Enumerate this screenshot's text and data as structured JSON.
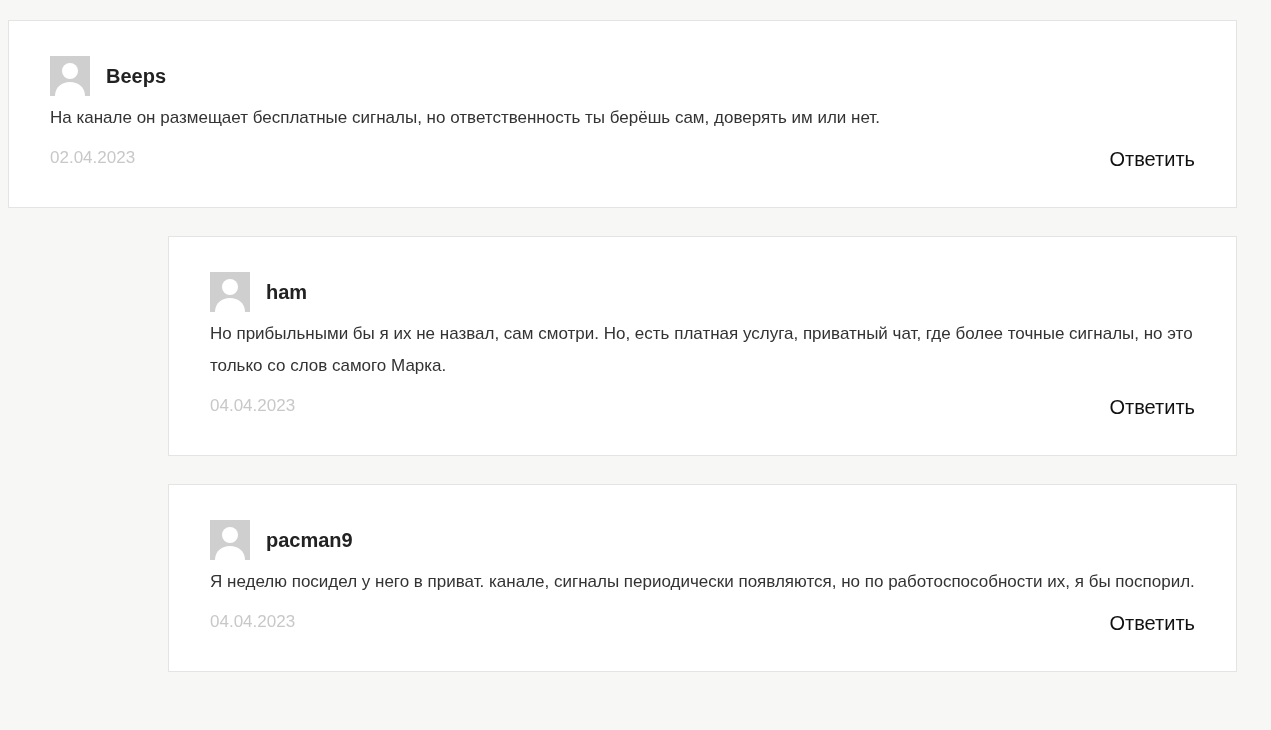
{
  "comments": [
    {
      "author": "Beeps",
      "text": "На канале он размещает бесплатные сигналы, но ответственность ты берёшь сам, доверять им или нет.",
      "date": "02.04.2023",
      "reply_label": "Ответить",
      "children": [
        {
          "author": "ham",
          "text": "Но прибыльными бы я их не назвал, сам смотри. Но, есть платная услуга, приватный чат, где более точные сигналы, но это только со слов самого Марка.",
          "date": "04.04.2023",
          "reply_label": "Ответить"
        },
        {
          "author": "pacman9",
          "text": "Я неделю посидел у него в приват. канале, сигналы периодически появляются, но по работоспособности их, я бы поспорил.",
          "date": "04.04.2023",
          "reply_label": "Ответить"
        }
      ]
    }
  ]
}
